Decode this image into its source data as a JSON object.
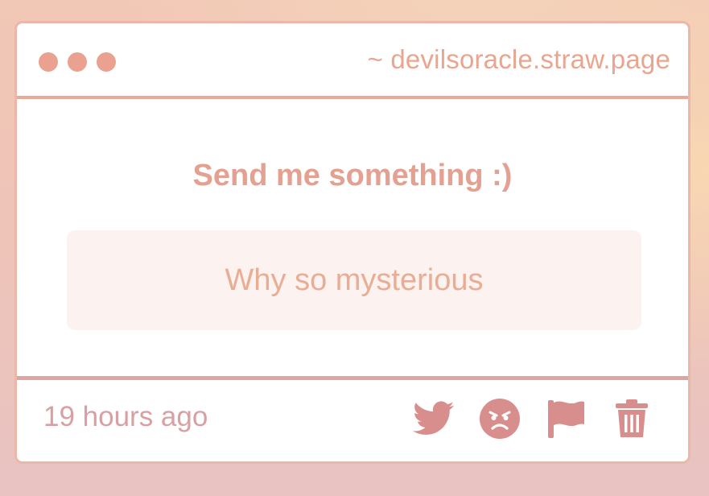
{
  "window": {
    "url": "~ devilsoracle.straw.page"
  },
  "content": {
    "heading": "Send me something :)",
    "message": "Why so mysterious"
  },
  "footer": {
    "timestamp": "19 hours ago",
    "actions": [
      {
        "icon": "twitter-icon"
      },
      {
        "icon": "angry-face-icon"
      },
      {
        "icon": "flag-icon"
      },
      {
        "icon": "trash-icon"
      }
    ]
  },
  "colors": {
    "accent": "#eaa18f",
    "footer_icons": "#d98e8e",
    "message_bg": "#fcf2ef"
  }
}
